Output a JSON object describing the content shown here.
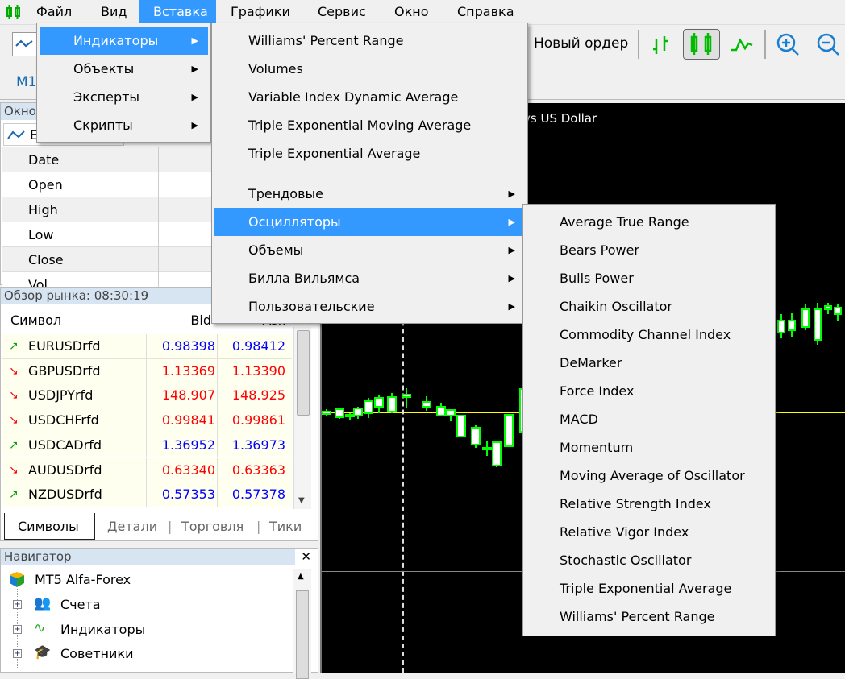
{
  "menubar": {
    "items": [
      "Файл",
      "Вид",
      "Вставка",
      "Графики",
      "Сервис",
      "Окно",
      "Справка"
    ],
    "active": "Вставка"
  },
  "toolbar": {
    "new_order": "Новый ордер",
    "timeframe": "M1"
  },
  "chart": {
    "title_partial": "vs US Dollar",
    "colors": {
      "background": "#000000",
      "candle": "#00ff00",
      "bid_line": "#ffff00"
    }
  },
  "data_window": {
    "title": "Окно",
    "symbol_partial": "E",
    "rows": [
      "Date",
      "Open",
      "High",
      "Low",
      "Close",
      "Vol"
    ]
  },
  "market_watch": {
    "title": "Обзор рынка: 08:30:19",
    "headers": {
      "symbol": "Символ",
      "bid": "Bid",
      "ask": "Ask"
    },
    "rows": [
      {
        "symbol": "EURUSDrfd",
        "bid": "0.98398",
        "ask": "0.98412",
        "dir": "up"
      },
      {
        "symbol": "GBPUSDrfd",
        "bid": "1.13369",
        "ask": "1.13390",
        "dir": "down"
      },
      {
        "symbol": "USDJPYrfd",
        "bid": "148.907",
        "ask": "148.925",
        "dir": "down"
      },
      {
        "symbol": "USDCHFrfd",
        "bid": "0.99841",
        "ask": "0.99861",
        "dir": "down"
      },
      {
        "symbol": "USDCADrfd",
        "bid": "1.36952",
        "ask": "1.36973",
        "dir": "up"
      },
      {
        "symbol": "AUDUSDrfd",
        "bid": "0.63340",
        "ask": "0.63363",
        "dir": "down"
      },
      {
        "symbol": "NZDUSDrfd",
        "bid": "0.57353",
        "ask": "0.57378",
        "dir": "up"
      }
    ],
    "tabs": [
      "Символы",
      "Детали",
      "Торговля",
      "Тики"
    ],
    "active_tab": "Символы"
  },
  "navigator": {
    "title": "Навигатор",
    "root": "MT5 Alfa-Forex",
    "items": [
      "Счета",
      "Индикаторы",
      "Советники"
    ]
  },
  "insert_menu": {
    "items": [
      "Индикаторы",
      "Объекты",
      "Эксперты",
      "Скрипты"
    ],
    "highlighted": "Индикаторы"
  },
  "indicators_menu": {
    "recent": [
      "Williams' Percent Range",
      "Volumes",
      "Variable Index Dynamic Average",
      "Triple Exponential Moving Average",
      "Triple Exponential Average"
    ],
    "groups": [
      "Трендовые",
      "Осцилляторы",
      "Объемы",
      "Билла Вильямса",
      "Пользовательские"
    ],
    "highlighted": "Осцилляторы"
  },
  "oscillators_menu": {
    "items": [
      "Average True Range",
      "Bears Power",
      "Bulls Power",
      "Chaikin Oscillator",
      "Commodity Channel Index",
      "DeMarker",
      "Force Index",
      "MACD",
      "Momentum",
      "Moving Average of Oscillator",
      "Relative Strength Index",
      "Relative Vigor Index",
      "Stochastic Oscillator",
      "Triple Exponential Average",
      "Williams' Percent Range"
    ]
  },
  "colors": {
    "menu_highlight": "#3399ff",
    "up": "#00a000",
    "down": "#ff0000",
    "bid_up": "#0000ff",
    "bid_down": "#ff0000"
  }
}
